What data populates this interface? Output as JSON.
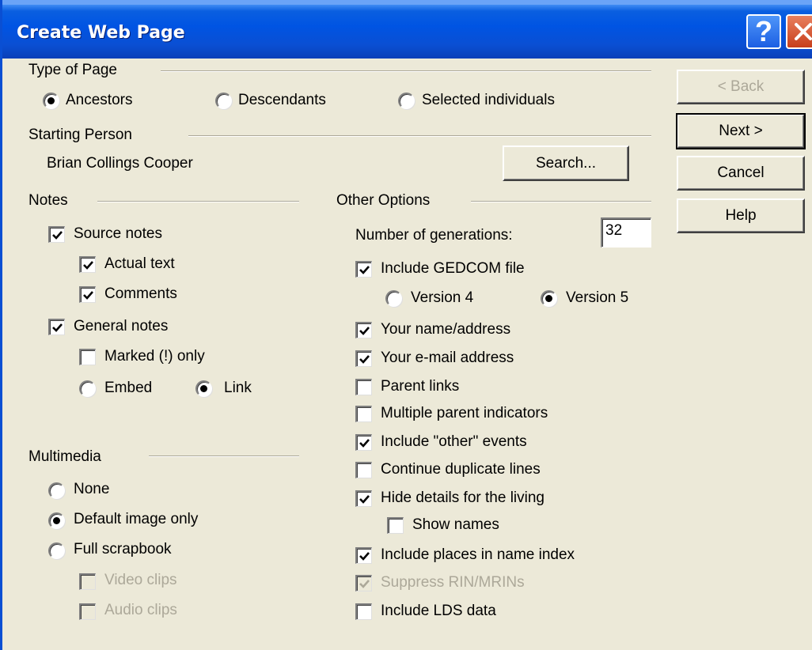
{
  "window": {
    "title": "Create Web Page",
    "help_icon": "question-mark-icon",
    "close_icon": "close-x-icon"
  },
  "type_of_page": {
    "label": "Type of Page",
    "options": [
      "Ancestors",
      "Descendants",
      "Selected individuals"
    ],
    "selected": "Ancestors"
  },
  "starting_person": {
    "label": "Starting Person",
    "name": "Brian Collings Cooper",
    "search_label": "Search..."
  },
  "buttons": {
    "back": "< Back",
    "next": "Next >",
    "cancel": "Cancel",
    "help": "Help"
  },
  "notes": {
    "label": "Notes",
    "source_notes": {
      "label": "Source notes",
      "checked": true
    },
    "actual_text": {
      "label": "Actual text",
      "checked": true
    },
    "comments": {
      "label": "Comments",
      "checked": true
    },
    "general_notes": {
      "label": "General notes",
      "checked": true
    },
    "marked_only": {
      "label": "Marked (!) only",
      "checked": false
    },
    "embed": "Embed",
    "link": "Link",
    "selected_mode": "Link"
  },
  "multimedia": {
    "label": "Multimedia",
    "options": [
      "None",
      "Default image only",
      "Full scrapbook"
    ],
    "selected": "Default image only",
    "video_clips": {
      "label": "Video clips",
      "checked": false,
      "enabled": false
    },
    "audio_clips": {
      "label": "Audio clips",
      "checked": false,
      "enabled": false
    }
  },
  "other_options": {
    "label": "Other Options",
    "generations_label": "Number of generations:",
    "generations_value": "32",
    "include_gedcom": {
      "label": "Include GEDCOM file",
      "checked": true
    },
    "version4": "Version 4",
    "version5": "Version 5",
    "selected_version": "Version 5",
    "your_name_address": {
      "label": "Your name/address",
      "checked": true
    },
    "your_email": {
      "label": "Your e-mail address",
      "checked": true
    },
    "parent_links": {
      "label": "Parent links",
      "checked": false
    },
    "multiple_parent": {
      "label": "Multiple parent indicators",
      "checked": false
    },
    "other_events": {
      "label": "Include \"other\" events",
      "checked": true
    },
    "continue_duplicate": {
      "label": "Continue duplicate lines",
      "checked": false
    },
    "hide_living": {
      "label": "Hide details for the living",
      "checked": true
    },
    "show_names": {
      "label": "Show names",
      "checked": false
    },
    "places_in_index": {
      "label": "Include places in name index",
      "checked": true
    },
    "suppress_rin": {
      "label": "Suppress RIN/MRINs",
      "checked": true,
      "enabled": false
    },
    "include_lds": {
      "label": "Include LDS data",
      "checked": false
    }
  },
  "colors": {
    "dialog_bg": "#ece9d8",
    "titlebar": "#0054e3",
    "disabled_text": "#aca899"
  }
}
